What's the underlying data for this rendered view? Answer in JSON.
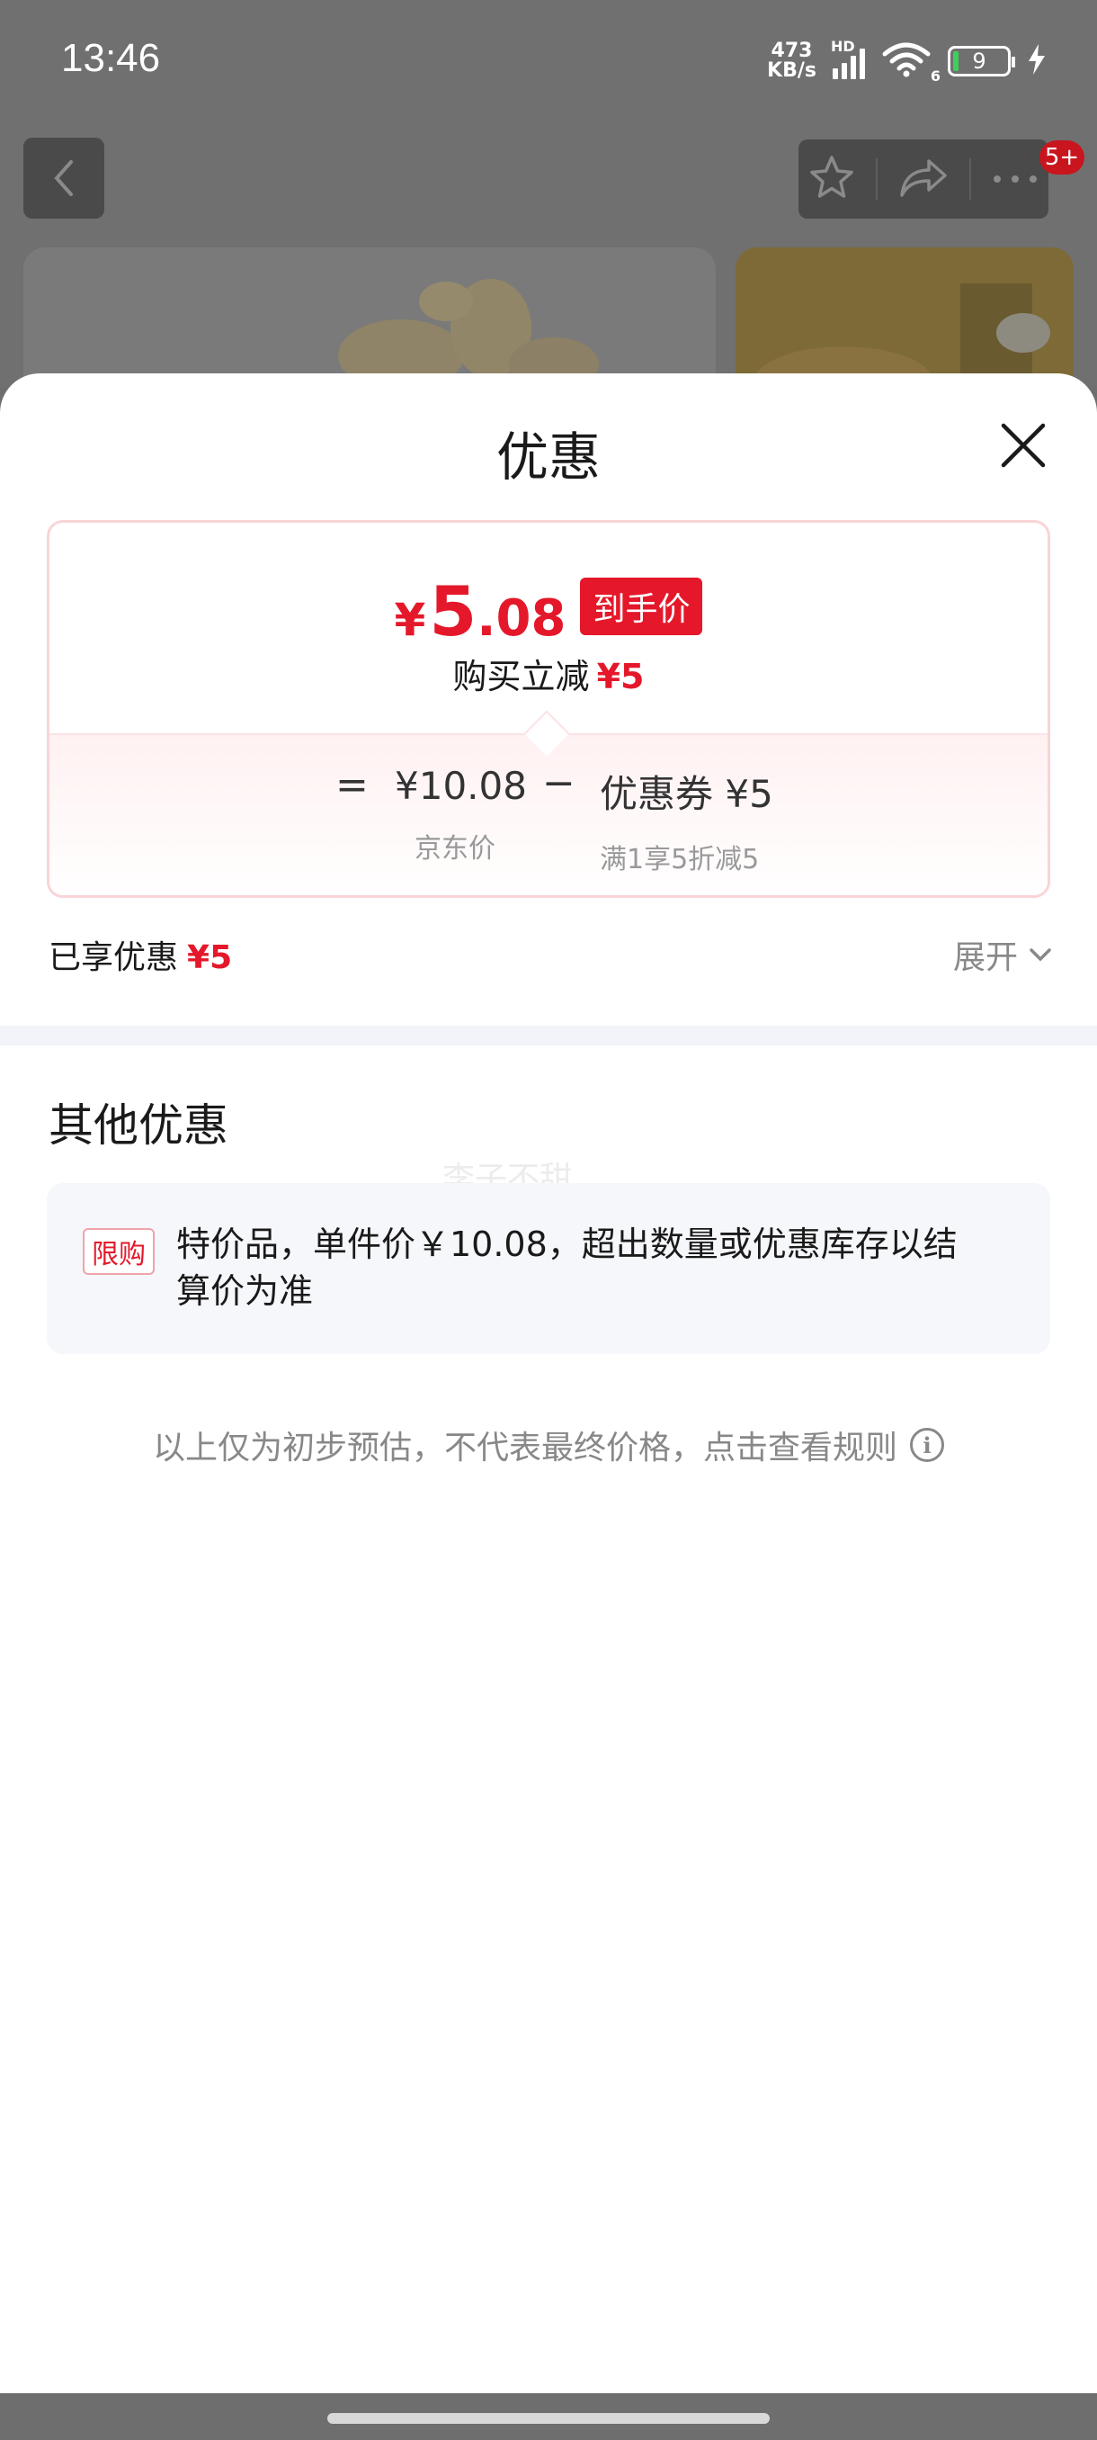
{
  "status_bar": {
    "time": "13:46",
    "net_speed_value": "473",
    "net_speed_unit": "KB/s",
    "network_label": "HD",
    "wifi_label": "6",
    "battery_level": "9"
  },
  "header": {
    "cart_badge": "5+"
  },
  "sheet": {
    "title": "优惠",
    "final_price": {
      "currency": "¥",
      "integer": "5",
      "decimal": ".08",
      "tag": "到手价"
    },
    "reduction": {
      "label": "购买立减",
      "amount": "¥5"
    },
    "breakdown": {
      "equals": "=",
      "base_price": "¥10.08",
      "base_label": "京东价",
      "minus": "−",
      "coupon_value": "优惠券 ¥5",
      "coupon_label": "满1享5折减5"
    },
    "enjoyed": {
      "label": "已享优惠",
      "amount": "¥5",
      "expand_label": "展开"
    },
    "other": {
      "title": "其他优惠",
      "watermark": "李子不甜",
      "promo_tag": "限购",
      "promo_text": "特价品，单件价￥10.08，超出数量或优惠库存以结算价为准"
    },
    "footnote": "以上仅为初步预估，不代表最终价格，点击查看规则"
  },
  "colors": {
    "accent_red": "#e4182a",
    "overlay_gray": "#707070",
    "band_gray": "#f3f4f9"
  }
}
